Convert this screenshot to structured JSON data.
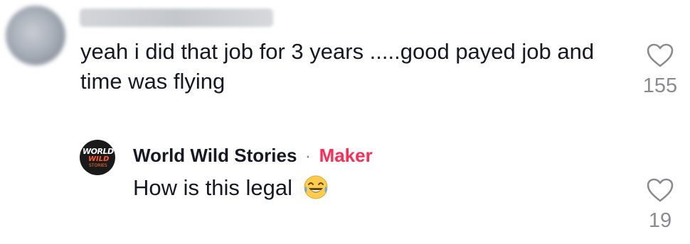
{
  "comment": {
    "text": "yeah i did that job for 3 years .....good payed job and time was flying",
    "like_count": "155"
  },
  "reply": {
    "author": "World Wild Stories",
    "separator": "·",
    "badge": "Maker",
    "text": "How is this legal",
    "emoji": "face-with-tears-of-joy",
    "like_count": "19",
    "avatar_logo": {
      "line1": "WORLD",
      "line2": "WILD",
      "line3": "STORIES"
    }
  },
  "colors": {
    "text": "#161823",
    "muted": "#8a8b91",
    "maker": "#fe2c55"
  },
  "icons": {
    "like": "heart-outline-icon"
  }
}
